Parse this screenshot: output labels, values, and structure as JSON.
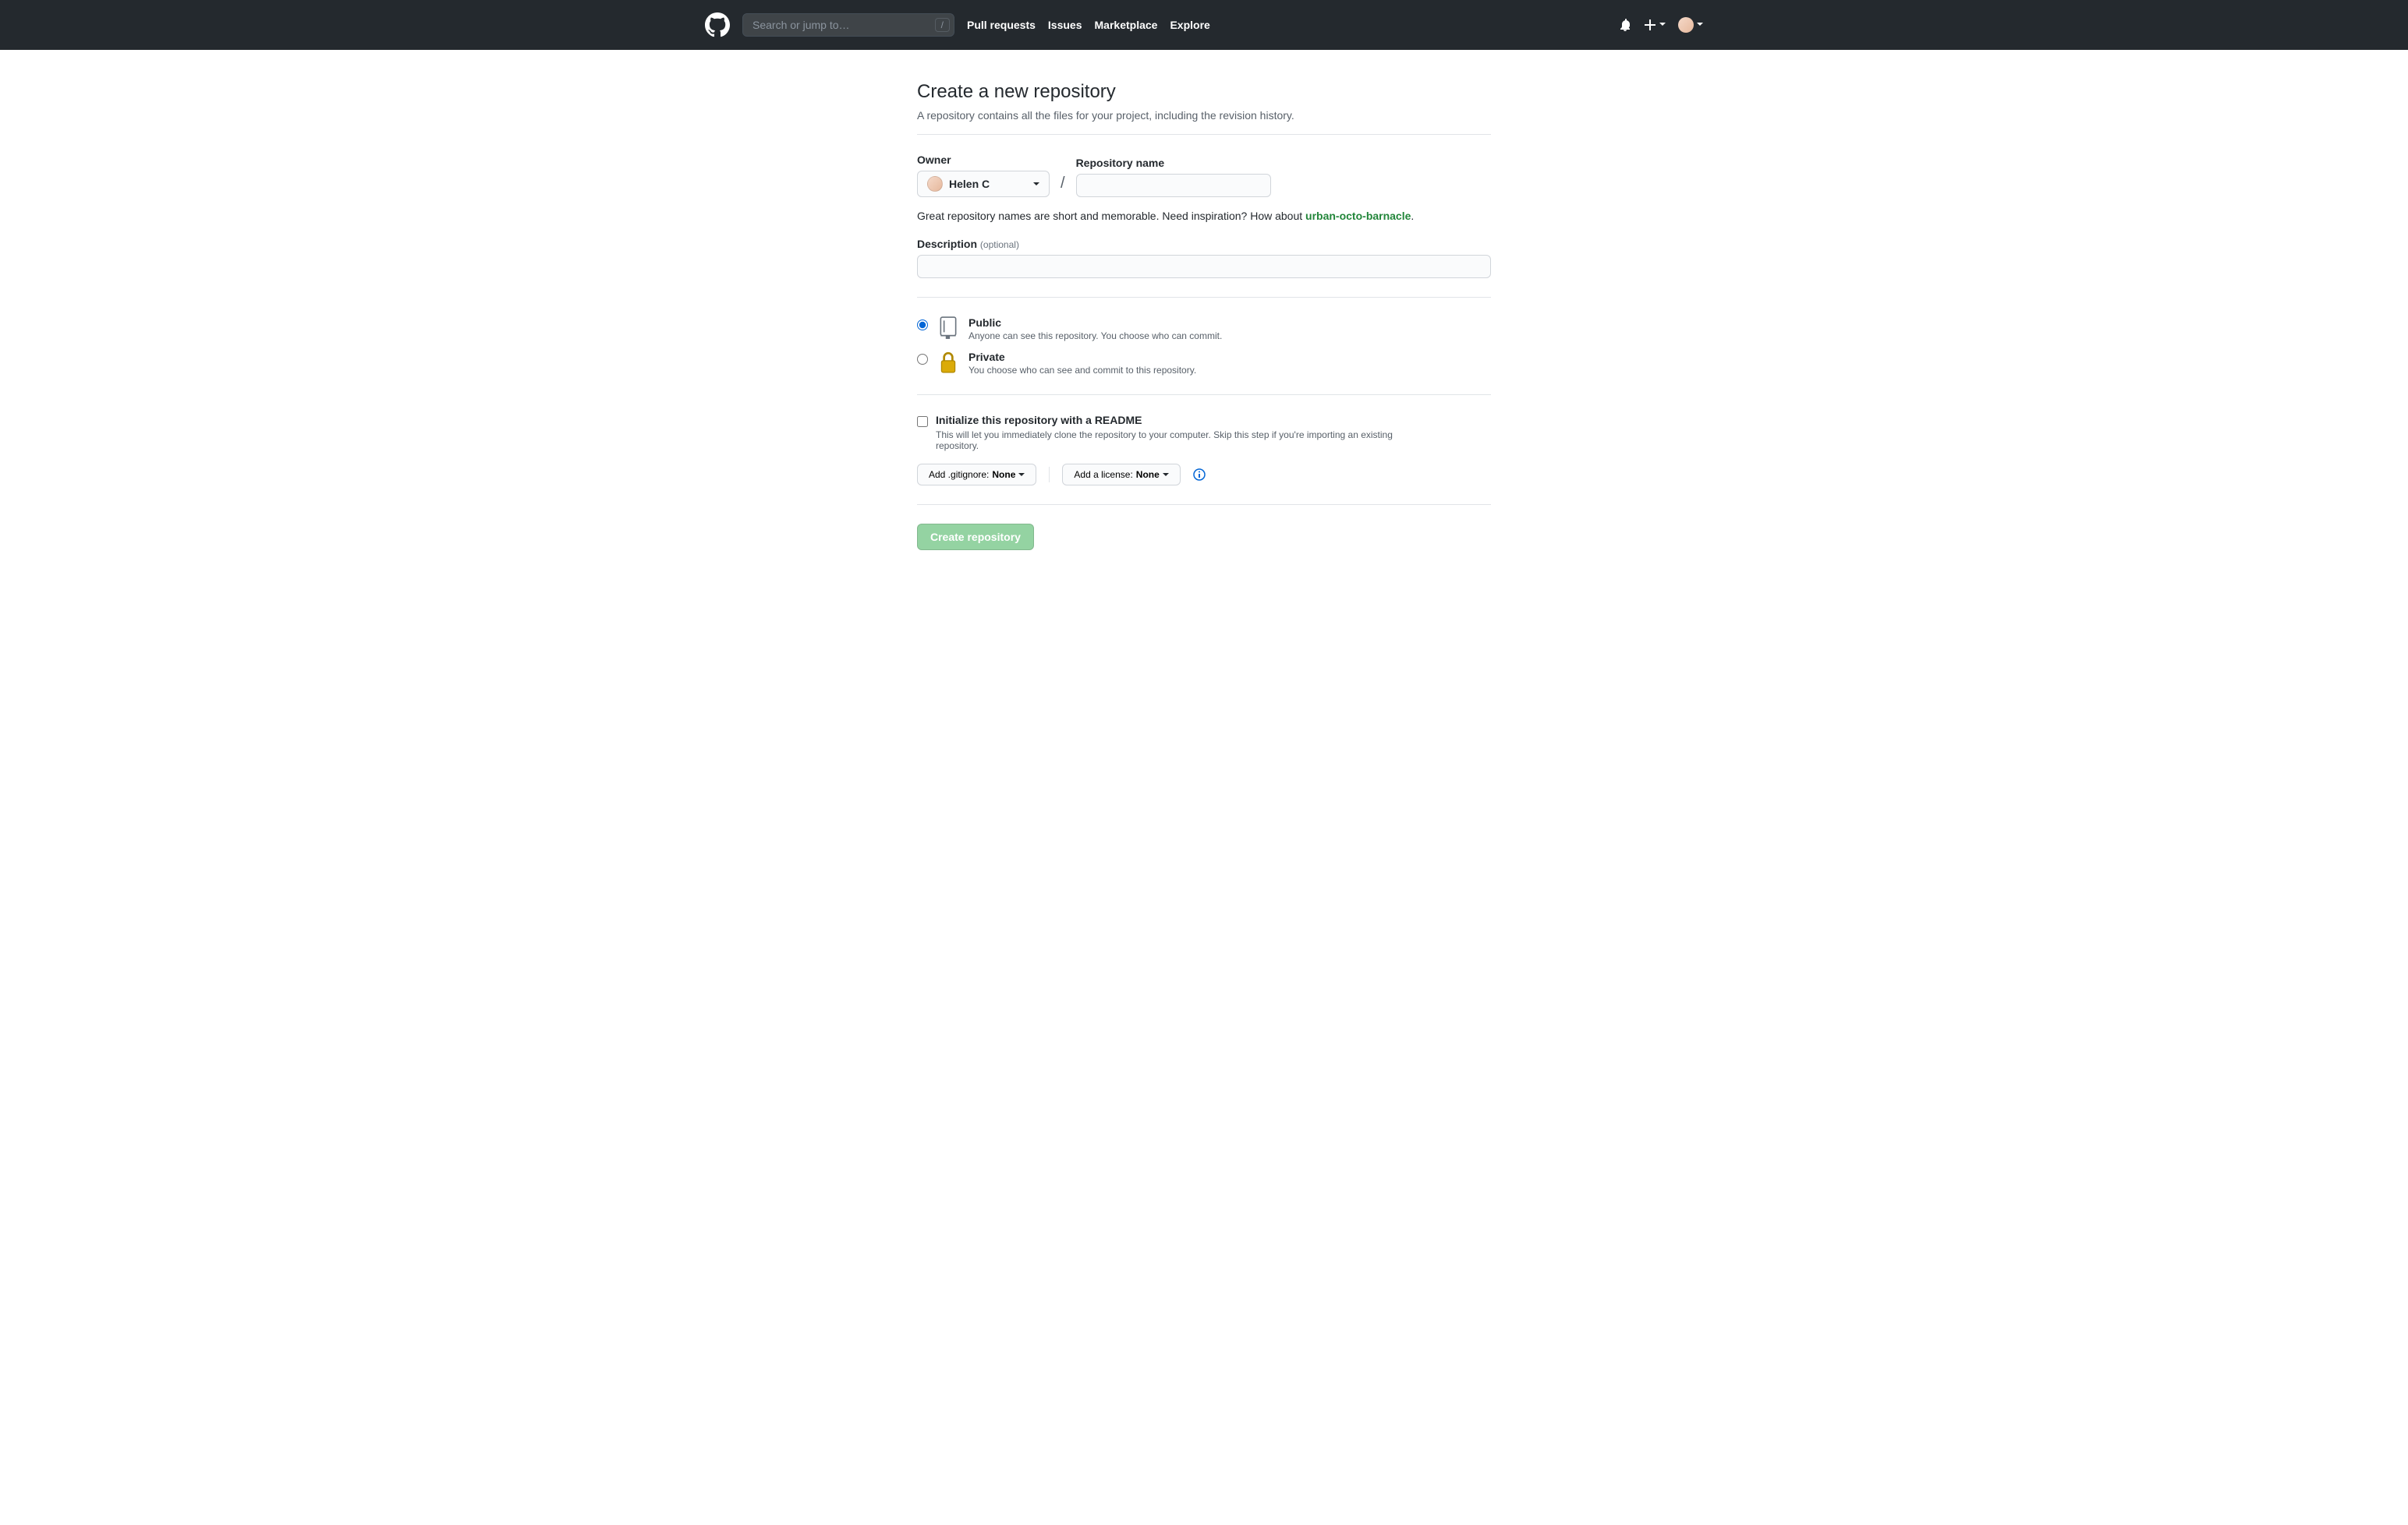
{
  "header": {
    "search_placeholder": "Search or jump to…",
    "slash_key": "/",
    "nav": [
      "Pull requests",
      "Issues",
      "Marketplace",
      "Explore"
    ]
  },
  "page": {
    "title": "Create a new repository",
    "subtitle": "A repository contains all the files for your project, including the revision history."
  },
  "owner": {
    "label": "Owner",
    "selected": "Helen C"
  },
  "repo_name": {
    "label": "Repository name",
    "value": ""
  },
  "hint": {
    "prefix": "Great repository names are short and memorable. Need inspiration? How about ",
    "suggestion": "urban-octo-barnacle",
    "suffix": "."
  },
  "description": {
    "label": "Description",
    "optional": "(optional)",
    "value": ""
  },
  "visibility": {
    "public": {
      "title": "Public",
      "desc": "Anyone can see this repository. You choose who can commit."
    },
    "private": {
      "title": "Private",
      "desc": "You choose who can see and commit to this repository."
    }
  },
  "readme": {
    "title": "Initialize this repository with a README",
    "desc": "This will let you immediately clone the repository to your computer. Skip this step if you're importing an existing repository."
  },
  "gitignore": {
    "label": "Add .gitignore: ",
    "value": "None"
  },
  "license": {
    "label": "Add a license: ",
    "value": "None"
  },
  "submit_label": "Create repository"
}
